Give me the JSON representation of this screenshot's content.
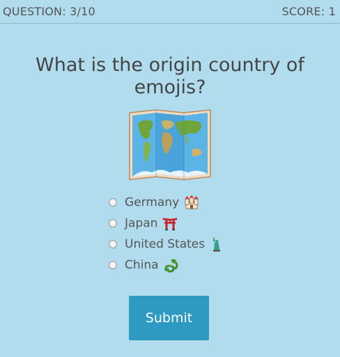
{
  "header": {
    "progress": "QUESTION: 3/10",
    "score_label": "SCORE:",
    "score_value": "1"
  },
  "question": {
    "text": "What is the origin country of emojis?",
    "image_icon": "world-map-icon"
  },
  "options": [
    {
      "label": "Germany",
      "icon": "castle-icon"
    },
    {
      "label": "Japan",
      "icon": "torii-gate-icon"
    },
    {
      "label": "United States",
      "icon": "statue-of-liberty-icon"
    },
    {
      "label": "China",
      "icon": "dragon-icon"
    }
  ],
  "submit_label": "Submit",
  "colors": {
    "background": "#b0dcee",
    "button": "#2e9ac2",
    "text": "#444444"
  }
}
